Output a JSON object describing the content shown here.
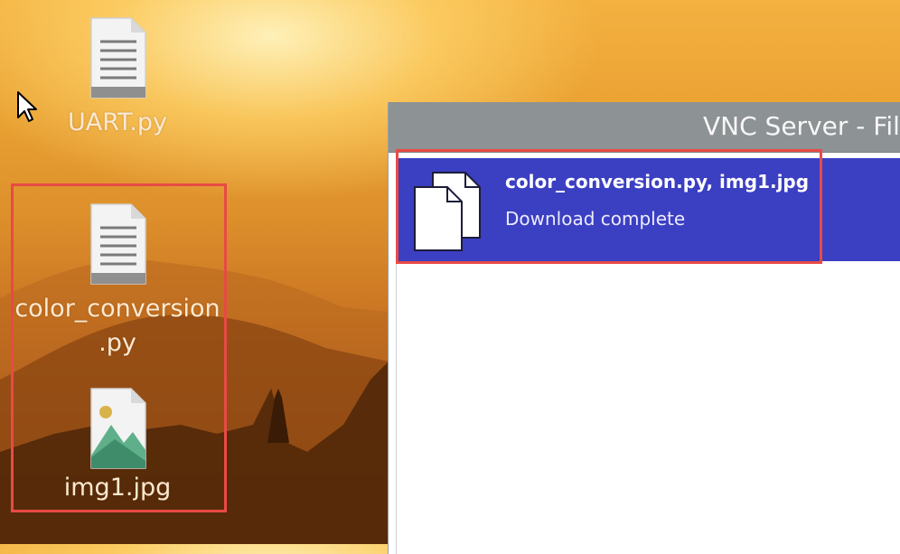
{
  "desktop": {
    "icons": [
      {
        "name": "UART.py",
        "type": "python-file-icon"
      },
      {
        "name_line1": "color_conversion",
        "name_line2": ".py",
        "type": "python-file-icon"
      },
      {
        "name": "img1.jpg",
        "type": "image-file-icon"
      }
    ]
  },
  "window": {
    "title": "VNC Server - File",
    "transfer": {
      "files": "color_conversion.py, img1.jpg",
      "status": "Download complete",
      "icon": "documents-icon"
    }
  },
  "colors": {
    "highlight": "#e84a45",
    "selected_row": "#3b3fc2",
    "titlebar": "#8d9295"
  }
}
